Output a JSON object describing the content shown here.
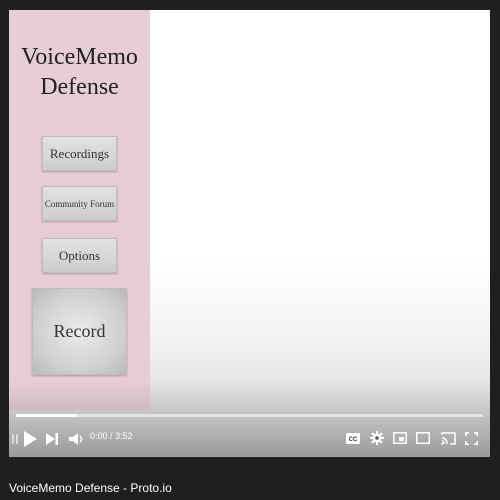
{
  "page": {
    "caption": "VoiceMemo Defense - Proto.io"
  },
  "app": {
    "title_line1": "VoiceMemo",
    "title_line2": "Defense",
    "buttons": {
      "recordings": "Recordings",
      "community_forum": "Community Forum",
      "options": "Options",
      "record": "Record"
    }
  },
  "player": {
    "time_current": "0:00",
    "time_separator": " / ",
    "time_total": "3:52",
    "progress_fraction": 0.0,
    "buffered_fraction": 0.13,
    "icons": {
      "play": "play-icon",
      "next": "next-icon",
      "volume": "volume-icon",
      "captions": "cc-icon",
      "settings": "gear-icon",
      "miniplayer": "miniplayer-icon",
      "theater": "theater-icon",
      "cast": "cast-icon",
      "fullscreen": "fullscreen-icon"
    }
  },
  "colors": {
    "sidebar": "#e7ced4",
    "page_background": "#1f1f1f",
    "controls": "#ffffff"
  }
}
